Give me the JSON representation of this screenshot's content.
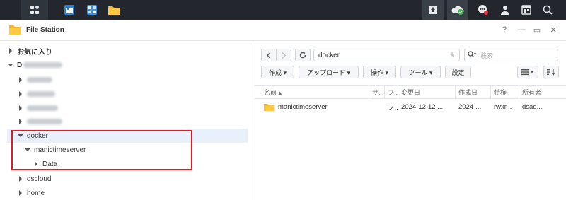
{
  "app": {
    "title": "File Station"
  },
  "window_controls": {
    "help": "?",
    "minimize": "—",
    "maximize": "▭",
    "close": "✕"
  },
  "tree": {
    "favorites_label": "お気に入り",
    "volume_label": "D",
    "items": {
      "docker": "docker",
      "manictimeserver": "manictimeserver",
      "data": "Data",
      "dscloud": "dscloud",
      "home": "home"
    }
  },
  "toolbar": {
    "path": "docker",
    "search_placeholder": "検索",
    "create": "作成 ▾",
    "upload": "アップロード ▾",
    "action": "操作 ▾",
    "tools": "ツール ▾",
    "settings": "設定"
  },
  "columns": {
    "name": "名前 ▴",
    "size": "サ...",
    "type": "フ...",
    "modified": "変更日",
    "created": "作成日",
    "permissions": "特権",
    "owner": "所有者"
  },
  "files": [
    {
      "name": "manictimeserver",
      "type": "フ...",
      "modified": "2024-12-12 ...",
      "created": "2024-...",
      "permissions": "rwxr...",
      "owner": "dsad..."
    }
  ],
  "colors": {
    "highlight_box": "#e01b24",
    "selected_row": "#e8f1fb",
    "taskbar": "#23272d"
  }
}
